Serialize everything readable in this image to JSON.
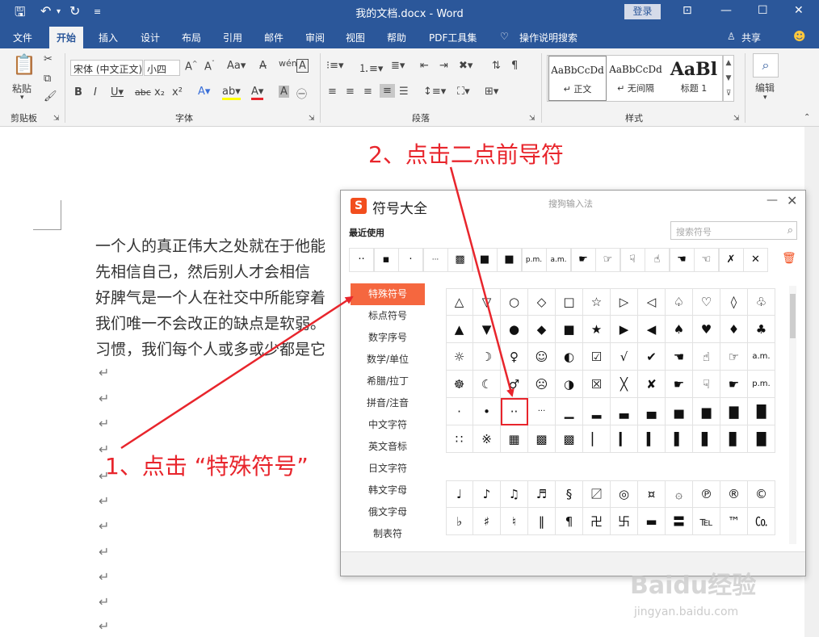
{
  "titlebar": {
    "doc_title": "我的文档.docx  -  Word",
    "login": "登录"
  },
  "tabs": [
    {
      "label": "文件"
    },
    {
      "label": "开始"
    },
    {
      "label": "插入"
    },
    {
      "label": "设计"
    },
    {
      "label": "布局"
    },
    {
      "label": "引用"
    },
    {
      "label": "邮件"
    },
    {
      "label": "审阅"
    },
    {
      "label": "视图"
    },
    {
      "label": "帮助"
    },
    {
      "label": "PDF工具集"
    },
    {
      "label": "操作说明搜索"
    }
  ],
  "share_label": "共享",
  "ribbon": {
    "paste_label": "粘贴",
    "clipboard_group": "剪贴板",
    "font_group": "字体",
    "paragraph_group": "段落",
    "styles_group": "样式",
    "edit_label": "编辑",
    "font_name": "宋体 (中文正文)",
    "font_size": "小四",
    "styles": [
      {
        "preview": "AaBbCcDd",
        "name": "↵ 正文"
      },
      {
        "preview": "AaBbCcDd",
        "name": "↵ 无间隔"
      },
      {
        "preview": "AaBl",
        "name": "标题 1"
      }
    ]
  },
  "document": {
    "lines": [
      "一个人的真正伟大之处就在于他能",
      "先相信自己，然后别人才会相信",
      "好脾气是一个人在社交中所能穿着",
      "我们唯一不会改正的缺点是软弱。",
      "习惯，我们每个人或多或少都是它"
    ],
    "para_mark": "↵"
  },
  "dialog": {
    "title": "符号大全",
    "subtitle": "搜狗输入法",
    "recent_label": "最近使用",
    "search_placeholder": "搜索符号",
    "recent_symbols": [
      "··",
      "▪",
      "·",
      "···",
      "▩",
      "■",
      "■",
      "p.m.",
      "a.m.",
      "☛",
      "☞",
      "☟",
      "☝",
      "☚",
      "☜",
      "✗",
      "✕"
    ],
    "categories": [
      "特殊符号",
      "标点符号",
      "数字序号",
      "数学/单位",
      "希腊/拉丁",
      "拼音/注音",
      "中文字符",
      "英文音标",
      "日文字符",
      "韩文字母",
      "俄文字母",
      "制表符"
    ],
    "grid1": [
      [
        "△",
        "▽",
        "○",
        "◇",
        "□",
        "☆",
        "▷",
        "◁",
        "♤",
        "♡",
        "◊",
        "♧"
      ],
      [
        "▲",
        "▼",
        "●",
        "◆",
        "■",
        "★",
        "▶",
        "◀",
        "♠",
        "♥",
        "♦",
        "♣"
      ],
      [
        "☼",
        "☽",
        "♀",
        "☺",
        "◐",
        "☑",
        "√",
        "✔",
        "☚",
        "☝",
        "☞",
        "a.m."
      ],
      [
        "☸",
        "☾",
        "♂",
        "☹",
        "◑",
        "☒",
        "╳",
        "✘",
        "☛",
        "☟",
        "☛",
        "p.m."
      ],
      [
        "·",
        "•",
        "··",
        "···",
        "▁",
        "▂",
        "▃",
        "▄",
        "▅",
        "▆",
        "▇",
        "█"
      ],
      [
        "∷",
        "※",
        "▦",
        "▩",
        "▩",
        "▏",
        "▎",
        "▍",
        "▌",
        "▋",
        "▊",
        "█"
      ]
    ],
    "grid2": [
      [
        "♩",
        "♪",
        "♫",
        "♬",
        "§",
        "〼",
        "◎",
        "¤",
        "۞",
        "℗",
        "®",
        "©"
      ],
      [
        "♭",
        "♯",
        "♮",
        "‖",
        "¶",
        "卍",
        "卐",
        "▬",
        "〓",
        "℡",
        "™",
        "㏇"
      ]
    ]
  },
  "annotations": {
    "step1": "1、点击 “特殊符号”",
    "step2": "2、点击二点前导符",
    "color": "#e8252c"
  },
  "watermark": {
    "brand": "Baidu经验",
    "url": "jingyan.baidu.com"
  },
  "colors": {
    "word_blue": "#2b579a",
    "sogou_orange": "#f5673f"
  }
}
